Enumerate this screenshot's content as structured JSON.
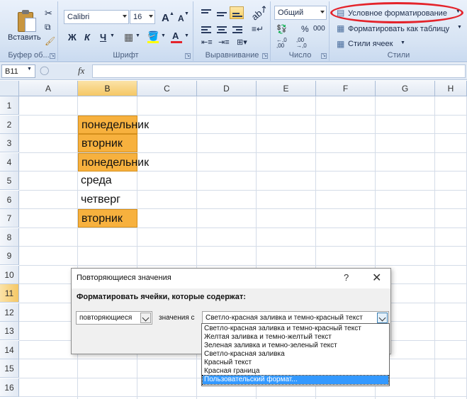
{
  "ribbon": {
    "clipboard": {
      "paste_label": "Вставить",
      "group_label": "Буфер об..."
    },
    "font": {
      "font_name": "Calibri",
      "font_size": "16",
      "grow_label": "A",
      "shrink_label": "A",
      "bold_label": "Ж",
      "italic_label": "К",
      "underline_label": "Ч",
      "font_color_label": "A",
      "group_label": "Шрифт"
    },
    "alignment": {
      "group_label": "Выравнивание"
    },
    "number": {
      "format": "Общий",
      "percent": "%",
      "thousands": "000",
      "inc_decimal": "←,0\n,00",
      "dec_decimal": ",00\n→,0",
      "group_label": "Число"
    },
    "styles": {
      "conditional_formatting": "Условное форматирование",
      "format_as_table": "Форматировать как таблицу",
      "cell_styles": "Стили ячеек",
      "group_label": "Стили"
    }
  },
  "formula_bar": {
    "name_box": "B11",
    "fx": "fx",
    "value": ""
  },
  "grid": {
    "columns": [
      "A",
      "B",
      "C",
      "D",
      "E",
      "F",
      "G",
      "H"
    ],
    "selected_column": "B",
    "rows": [
      "1",
      "2",
      "3",
      "4",
      "5",
      "6",
      "7",
      "8",
      "9",
      "10",
      "11",
      "12",
      "13",
      "14",
      "15",
      "16"
    ],
    "selected_row": "11",
    "cells": [
      {
        "row": 2,
        "text": "понедельник",
        "highlight": true
      },
      {
        "row": 3,
        "text": "вторник",
        "highlight": true
      },
      {
        "row": 4,
        "text": "понедельник",
        "highlight": true
      },
      {
        "row": 5,
        "text": "среда",
        "highlight": false
      },
      {
        "row": 6,
        "text": "четверг",
        "highlight": false
      },
      {
        "row": 7,
        "text": "вторник",
        "highlight": true
      }
    ]
  },
  "dialog": {
    "title": "Повторяющиеся значения",
    "help": "?",
    "close": "✕",
    "prompt": "Форматировать ячейки, которые содержат:",
    "rule_value": "повторяющиеся",
    "with_label": "значения с",
    "format_value": "Светло-красная заливка и темно-красный текст",
    "options": [
      "Светло-красная заливка и темно-красный текст",
      "Желтая заливка и темно-желтый текст",
      "Зеленая заливка и темно-зеленый текст",
      "Светло-красная заливка",
      "Красный текст",
      "Красная граница",
      "Пользовательский формат..."
    ],
    "selected_option_index": 6
  },
  "colors": {
    "highlight_fill": "#f7b13e",
    "annotation_red": "#e4232b",
    "selection_blue": "#3399ff"
  }
}
